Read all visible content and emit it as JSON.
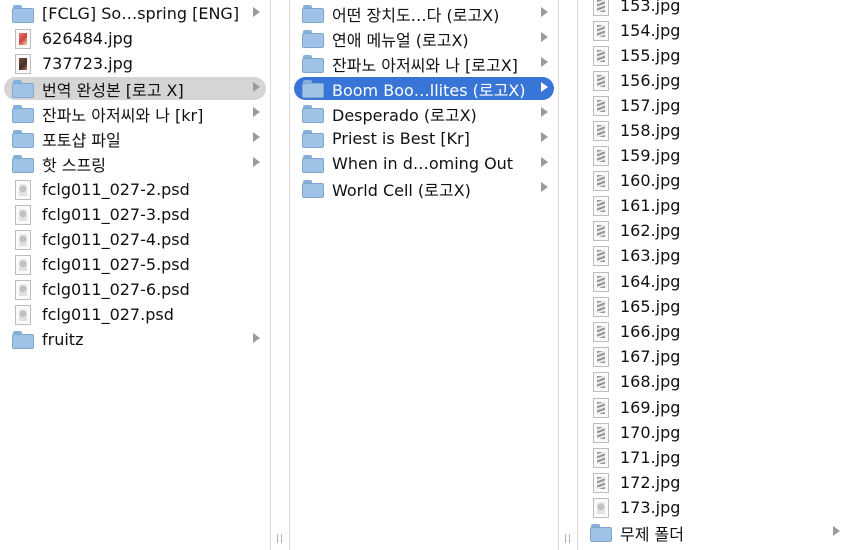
{
  "column1": {
    "items": [
      {
        "label": "[FCLG] So…spring [ENG]",
        "icon": "folder-icon",
        "arrow": true
      },
      {
        "label": "626484.jpg",
        "icon": "image-file-icon"
      },
      {
        "label": "737723.jpg",
        "icon": "image-file-icon"
      },
      {
        "label": "번역 완성본 [로고 X]",
        "icon": "folder-icon",
        "arrow": true,
        "selected": "inactive"
      },
      {
        "label": "잔파노 아저씨와 나 [kr]",
        "icon": "folder-icon",
        "arrow": true
      },
      {
        "label": "포토샵 파일",
        "icon": "folder-icon",
        "arrow": true
      },
      {
        "label": "핫 스프링",
        "icon": "folder-icon",
        "arrow": true
      },
      {
        "label": "fclg011_027-2.psd",
        "icon": "psd-file-icon"
      },
      {
        "label": "fclg011_027-3.psd",
        "icon": "psd-file-icon"
      },
      {
        "label": "fclg011_027-4.psd",
        "icon": "psd-file-icon"
      },
      {
        "label": "fclg011_027-5.psd",
        "icon": "psd-file-icon"
      },
      {
        "label": "fclg011_027-6.psd",
        "icon": "psd-file-icon"
      },
      {
        "label": "fclg011_027.psd",
        "icon": "psd-file-icon"
      },
      {
        "label": "fruitz",
        "icon": "folder-icon",
        "arrow": true
      }
    ]
  },
  "column2": {
    "items": [
      {
        "label": "어떤 장치도…다 (로고X)",
        "icon": "folder-icon",
        "arrow": true
      },
      {
        "label": "연애 메뉴얼 (로고X)",
        "icon": "folder-icon",
        "arrow": true
      },
      {
        "label": "잔파노 아저씨와 나 [로고X]",
        "icon": "folder-icon",
        "arrow": true
      },
      {
        "label": "Boom Boo…llites (로고X)",
        "icon": "folder-icon",
        "arrow": true,
        "selected": "active"
      },
      {
        "label": "Desperado (로고X)",
        "icon": "folder-icon",
        "arrow": true
      },
      {
        "label": "Priest is Best [Kr]",
        "icon": "folder-icon",
        "arrow": true
      },
      {
        "label": "When in d…oming Out",
        "icon": "folder-icon",
        "arrow": true
      },
      {
        "label": "World Cell (로고X)",
        "icon": "folder-icon",
        "arrow": true
      }
    ]
  },
  "column3": {
    "items": [
      {
        "label": "153.jpg",
        "icon": "image-file-icon"
      },
      {
        "label": "154.jpg",
        "icon": "image-file-icon"
      },
      {
        "label": "155.jpg",
        "icon": "image-file-icon"
      },
      {
        "label": "156.jpg",
        "icon": "image-file-icon"
      },
      {
        "label": "157.jpg",
        "icon": "image-file-icon"
      },
      {
        "label": "158.jpg",
        "icon": "image-file-icon"
      },
      {
        "label": "159.jpg",
        "icon": "image-file-icon"
      },
      {
        "label": "160.jpg",
        "icon": "image-file-icon"
      },
      {
        "label": "161.jpg",
        "icon": "image-file-icon"
      },
      {
        "label": "162.jpg",
        "icon": "image-file-icon"
      },
      {
        "label": "163.jpg",
        "icon": "image-file-icon"
      },
      {
        "label": "164.jpg",
        "icon": "image-file-icon"
      },
      {
        "label": "165.jpg",
        "icon": "image-file-icon"
      },
      {
        "label": "166.jpg",
        "icon": "image-file-icon"
      },
      {
        "label": "167.jpg",
        "icon": "image-file-icon"
      },
      {
        "label": "168.jpg",
        "icon": "image-file-icon"
      },
      {
        "label": "169.jpg",
        "icon": "image-file-icon"
      },
      {
        "label": "170.jpg",
        "icon": "image-file-icon"
      },
      {
        "label": "171.jpg",
        "icon": "image-file-icon"
      },
      {
        "label": "172.jpg",
        "icon": "image-file-icon"
      },
      {
        "label": "173.jpg",
        "icon": "image-file-icon"
      },
      {
        "label": "무제 폴더",
        "icon": "folder-icon",
        "arrow": true
      }
    ]
  },
  "colors": {
    "selection_active": "#3875d7",
    "selection_inactive": "#d5d5d5",
    "folder": "#9ec3e6"
  }
}
